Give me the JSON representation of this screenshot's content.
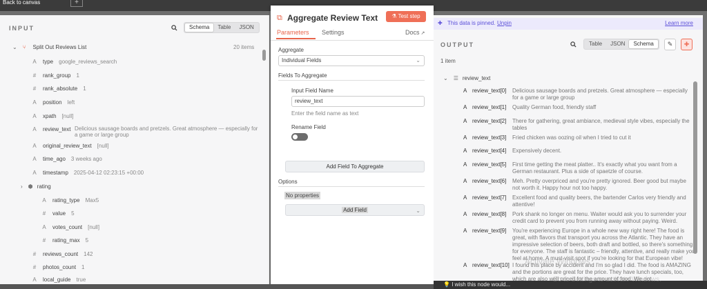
{
  "topbar": {
    "back": "Back to canvas",
    "plus": "+"
  },
  "input": {
    "title": "INPUT",
    "tabs": [
      "Schema",
      "Table",
      "JSON"
    ],
    "node_name": "Split Out Reviews List",
    "count": "20 items",
    "fields": [
      {
        "type": "A",
        "name": "type",
        "value": "google_reviews_search"
      },
      {
        "type": "#",
        "name": "rank_group",
        "value": "1"
      },
      {
        "type": "#",
        "name": "rank_absolute",
        "value": "1"
      },
      {
        "type": "A",
        "name": "position",
        "value": "left"
      },
      {
        "type": "A",
        "name": "xpath",
        "value": "[null]"
      },
      {
        "type": "A",
        "name": "review_text",
        "value": "Delicious sausage boards and pretzels. Great atmosphere — especially for a game or large group"
      },
      {
        "type": "A",
        "name": "original_review_text",
        "value": "[null]"
      },
      {
        "type": "A",
        "name": "time_ago",
        "value": "3 weeks ago"
      },
      {
        "type": "A",
        "name": "timestamp",
        "value": "2025-04-12 02:23:15 +00:00"
      }
    ],
    "rating": {
      "name": "rating",
      "fields": [
        {
          "type": "A",
          "name": "rating_type",
          "value": "Max5"
        },
        {
          "type": "#",
          "name": "value",
          "value": "5"
        },
        {
          "type": "A",
          "name": "votes_count",
          "value": "[null]"
        },
        {
          "type": "#",
          "name": "rating_max",
          "value": "5"
        }
      ]
    },
    "after": [
      {
        "type": "#",
        "name": "reviews_count",
        "value": "142"
      },
      {
        "type": "#",
        "name": "photos_count",
        "value": "1"
      },
      {
        "type": "A",
        "name": "local_guide",
        "value": "true"
      }
    ]
  },
  "node": {
    "title": "Aggregate Review Text",
    "test_step": "Test step",
    "tabs": {
      "parameters": "Parameters",
      "settings": "Settings",
      "docs": "Docs"
    },
    "aggregate_label": "Aggregate",
    "aggregate_value": "Individual Fields",
    "fields_label": "Fields To Aggregate",
    "input_field_label": "Input Field Name",
    "input_field_value": "review_text",
    "input_field_hint": "Enter the field name as text",
    "rename_label": "Rename Field",
    "add_field_agg": "Add Field To Aggregate",
    "options_label": "Options",
    "no_props": "No properties",
    "add_field": "Add Field"
  },
  "output": {
    "pinned": "This data is pinned.",
    "unpin": "Unpin",
    "learn": "Learn more",
    "title": "OUTPUT",
    "tabs": [
      "Table",
      "JSON",
      "Schema"
    ],
    "count": "1 item",
    "root": "review_text",
    "items": [
      {
        "name": "review_text[0]",
        "value": "Delicious sausage boards and pretzels. Great atmosphere — especially for a game or large group"
      },
      {
        "name": "review_text[1]",
        "value": "Quality German food, friendly staff"
      },
      {
        "name": "review_text[2]",
        "value": "There for gathering, great ambiance, medieval style vibes, especially the tables"
      },
      {
        "name": "review_text[3]",
        "value": "Fried chicken was oozing oil when I tried to cut it"
      },
      {
        "name": "review_text[4]",
        "value": "Expensively decent."
      },
      {
        "name": "review_text[5]",
        "value": "First time getting the meat platter.. It's exactly what you want from a German restaurant. Plus a side of spaetzle of course."
      },
      {
        "name": "review_text[6]",
        "value": "Meh. Pretty overpriced and you're pretty ignored. Beer good but maybe not worth it. Happy hour not too happy."
      },
      {
        "name": "review_text[7]",
        "value": "Excellent food and quality beers, the bartender Carlos very friendly and attentive!"
      },
      {
        "name": "review_text[8]",
        "value": "Pork shank no longer on menu. Waiter would ask you to surrender your credit card to prevent you from running away without paying. Weird."
      },
      {
        "name": "review_text[9]",
        "value": "You're experiencing Europe in a whole new way right here! The food is great, with flavors that transport you across the Atlantic. They have an impressive selection of beers, both draft and bottled, so there's something for everyone. The staff is fantastic – friendly, attentive, and really make you feel at home. A must-visit spot if you're looking for that European vibe!"
      },
      {
        "name": "review_text[10]",
        "value": "I found this place by accident and I'm so glad I did. The food is AMAZING and the portions are great for the price. They have lunch specials, too, which are also well priced for the amount of food. We got"
      }
    ]
  },
  "footer": {
    "wish": "I wish this node would...",
    "watermark": "Activate Windows",
    "watermark2": "Go to Settings to activate Windows."
  }
}
